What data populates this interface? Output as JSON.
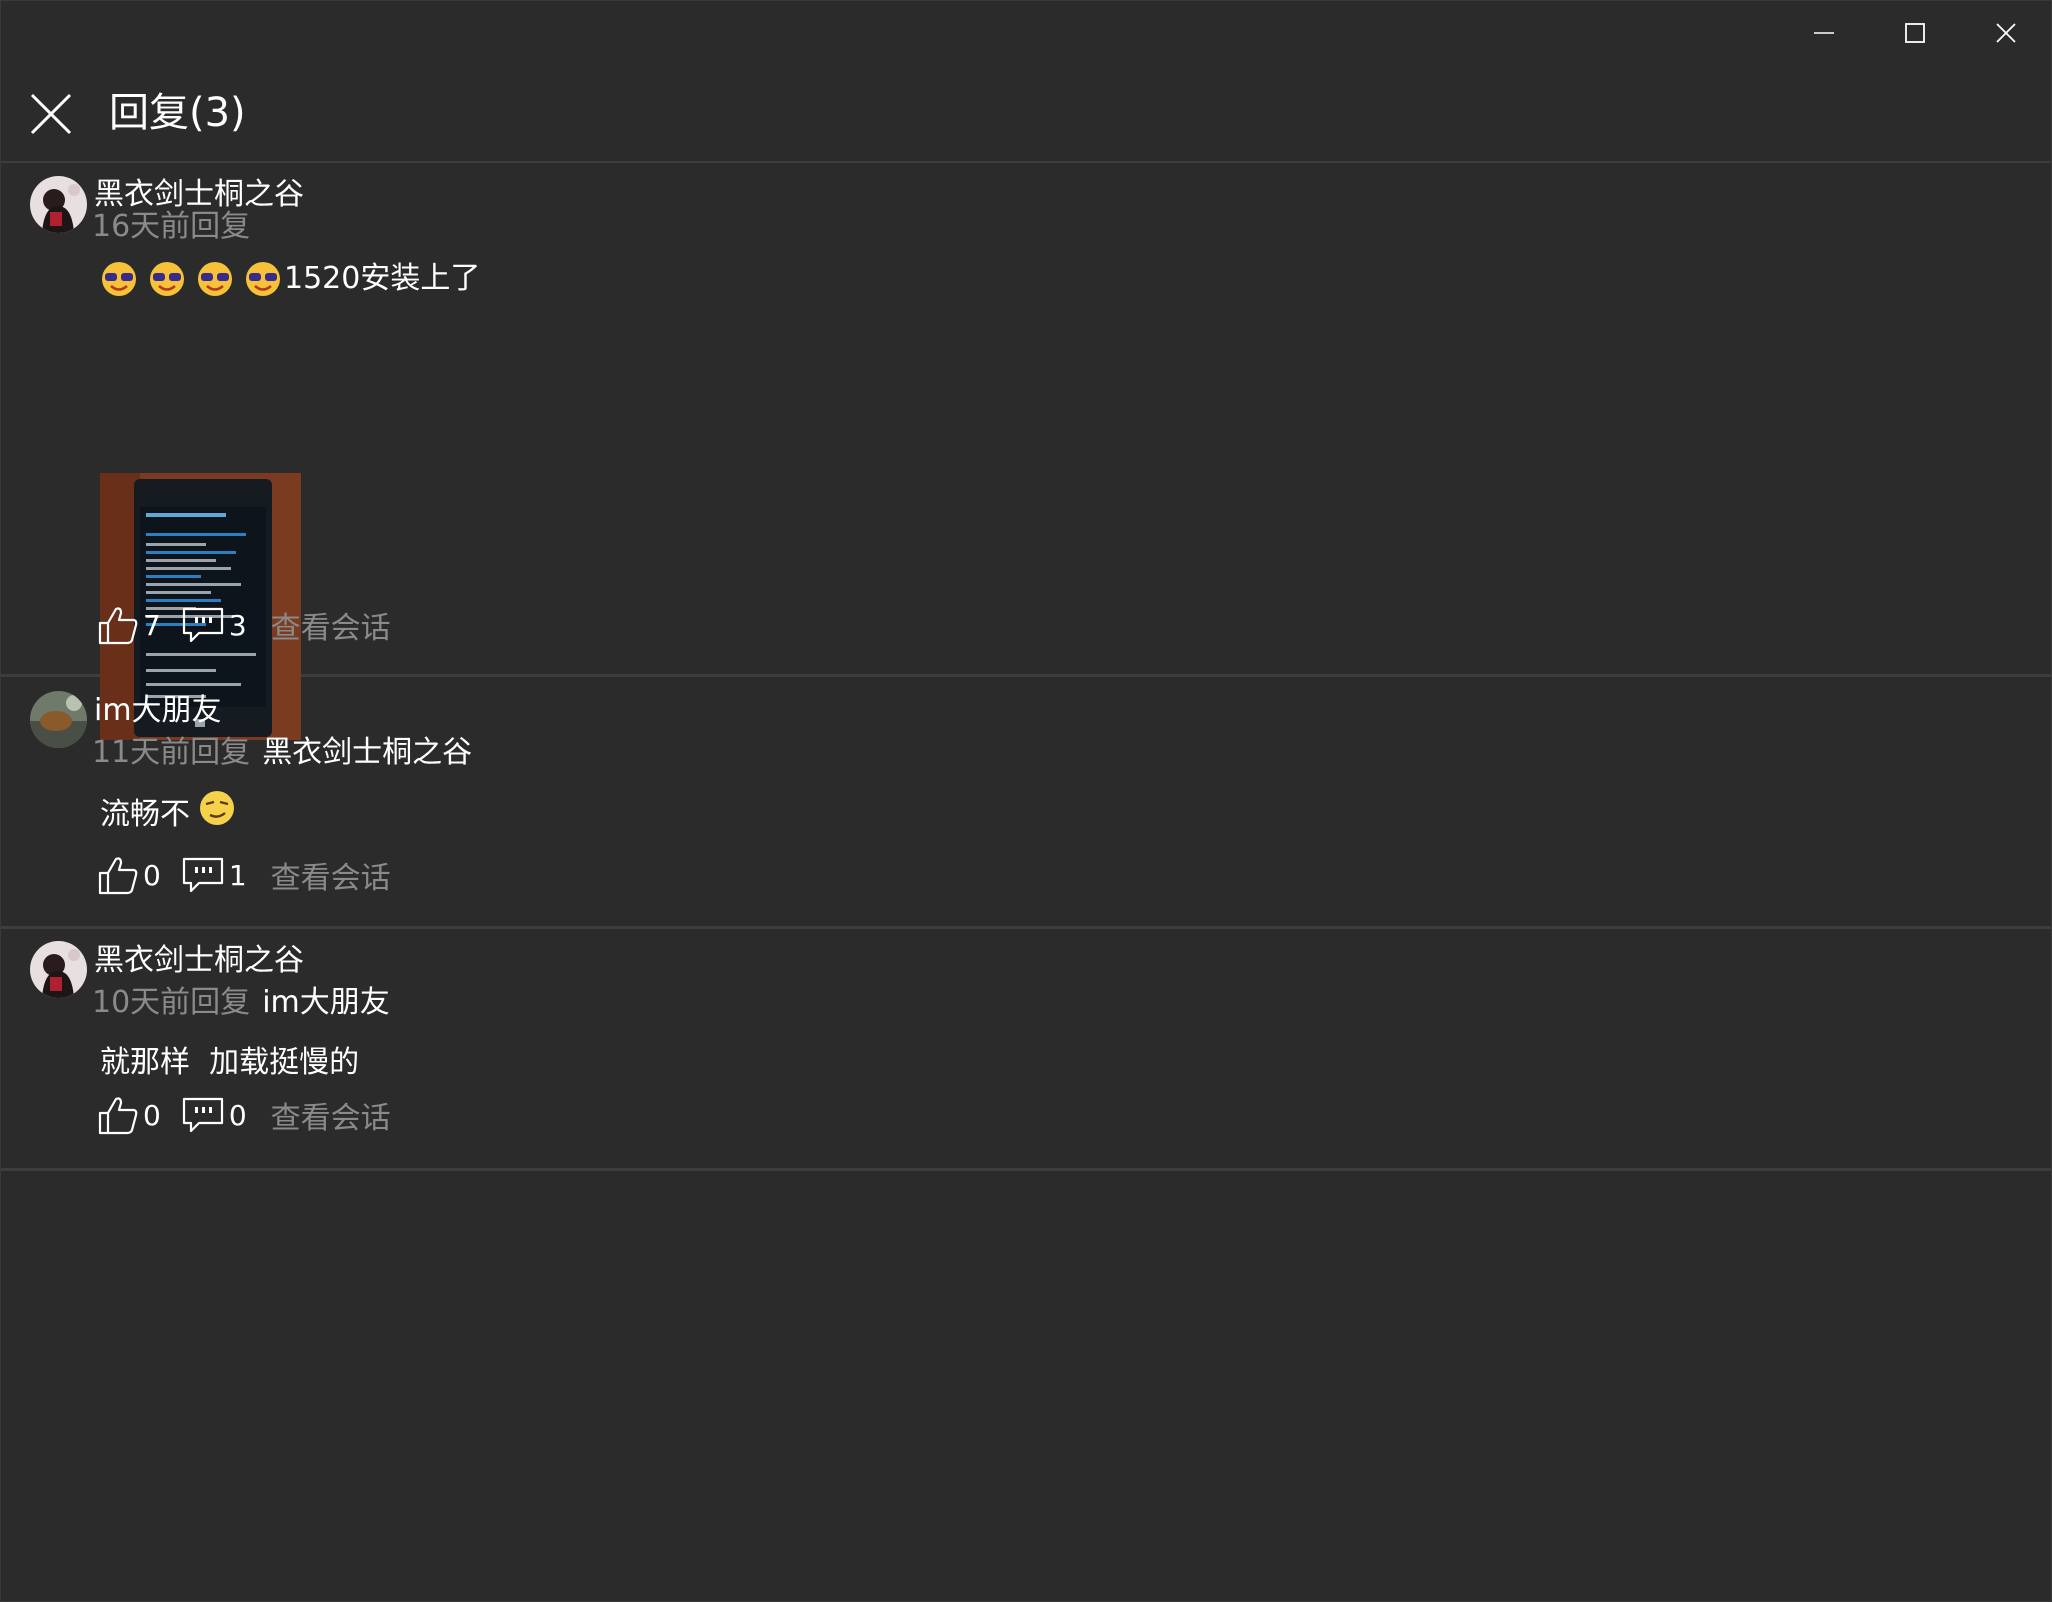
{
  "window": {
    "controls": [
      {
        "name": "minimize",
        "icon": "minimize-icon"
      },
      {
        "name": "maximize",
        "icon": "maximize-icon"
      },
      {
        "name": "close",
        "icon": "close-icon"
      }
    ]
  },
  "header": {
    "title": "回复(3)",
    "close_icon": "close-icon"
  },
  "replies": [
    {
      "username": "黑衣剑士桐之谷",
      "time": "16天前回复",
      "reply_to": "",
      "content": "1520安装上了",
      "emojis": [
        "emoji-sunglasses-icon",
        "emoji-sunglasses-icon",
        "emoji-sunglasses-icon",
        "emoji-sunglasses-icon"
      ],
      "has_image": true,
      "likes": "7",
      "comments": "3",
      "view_conversation": "查看会话"
    },
    {
      "username": "im大朋友",
      "time": "11天前回复",
      "reply_to": "黑衣剑士桐之谷",
      "content": "流畅不",
      "emojis": [
        "emoji-smug-icon"
      ],
      "has_image": false,
      "likes": "0",
      "comments": "1",
      "view_conversation": "查看会话"
    },
    {
      "username": "黑衣剑士桐之谷",
      "time": "10天前回复",
      "reply_to": "im大朋友",
      "content": "就那样  加载挺慢的",
      "emojis": [],
      "has_image": false,
      "likes": "0",
      "comments": "0",
      "view_conversation": "查看会话"
    }
  ],
  "colors": {
    "background": "#2b2b2b",
    "divider": "#3d3d3d",
    "secondary_text": "#8a8a8a",
    "primary_text": "#ffffff"
  }
}
